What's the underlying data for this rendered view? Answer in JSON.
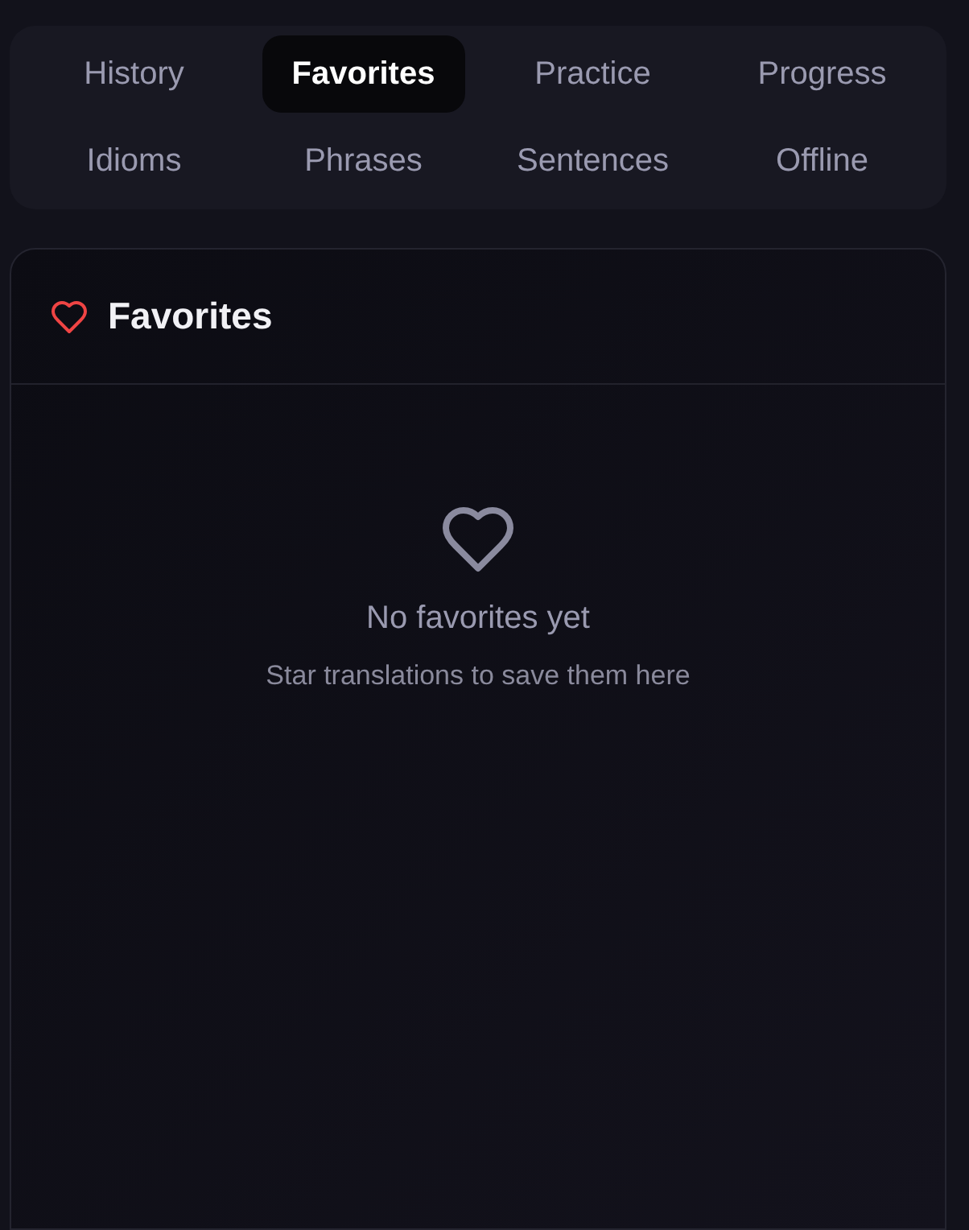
{
  "tabs": [
    {
      "label": "History",
      "selected": false
    },
    {
      "label": "Favorites",
      "selected": true
    },
    {
      "label": "Practice",
      "selected": false
    },
    {
      "label": "Progress",
      "selected": false
    },
    {
      "label": "Idioms",
      "selected": false
    },
    {
      "label": "Phrases",
      "selected": false
    },
    {
      "label": "Sentences",
      "selected": false
    },
    {
      "label": "Offline",
      "selected": false
    }
  ],
  "panel": {
    "title": "Favorites",
    "empty_title": "No favorites yet",
    "empty_hint": "Star translations to save them here"
  }
}
